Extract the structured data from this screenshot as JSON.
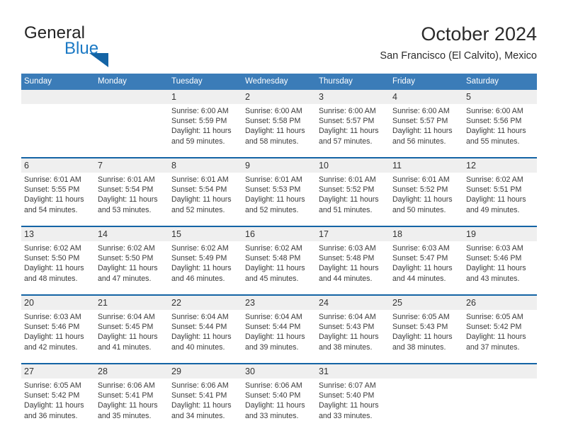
{
  "brand": {
    "name_part1": "General",
    "name_part2": "Blue",
    "triangle_color": "#1464a5",
    "blue_text_color": "#1b79c4"
  },
  "header": {
    "title": "October 2024",
    "subtitle": "San Francisco (El Calvito), Mexico",
    "accent_color": "#3b7cb8",
    "rule_color": "#1464a5",
    "daynum_band_color": "#efefef"
  },
  "weekday_headers": [
    "Sunday",
    "Monday",
    "Tuesday",
    "Wednesday",
    "Thursday",
    "Friday",
    "Saturday"
  ],
  "weeks": [
    {
      "days": [
        {
          "num": "",
          "sunrise": "",
          "sunset": "",
          "daylight_l1": "",
          "daylight_l2": "",
          "empty": true
        },
        {
          "num": "",
          "sunrise": "",
          "sunset": "",
          "daylight_l1": "",
          "daylight_l2": "",
          "empty": true
        },
        {
          "num": "1",
          "sunrise": "Sunrise: 6:00 AM",
          "sunset": "Sunset: 5:59 PM",
          "daylight_l1": "Daylight: 11 hours",
          "daylight_l2": "and 59 minutes.",
          "empty": false
        },
        {
          "num": "2",
          "sunrise": "Sunrise: 6:00 AM",
          "sunset": "Sunset: 5:58 PM",
          "daylight_l1": "Daylight: 11 hours",
          "daylight_l2": "and 58 minutes.",
          "empty": false
        },
        {
          "num": "3",
          "sunrise": "Sunrise: 6:00 AM",
          "sunset": "Sunset: 5:57 PM",
          "daylight_l1": "Daylight: 11 hours",
          "daylight_l2": "and 57 minutes.",
          "empty": false
        },
        {
          "num": "4",
          "sunrise": "Sunrise: 6:00 AM",
          "sunset": "Sunset: 5:57 PM",
          "daylight_l1": "Daylight: 11 hours",
          "daylight_l2": "and 56 minutes.",
          "empty": false
        },
        {
          "num": "5",
          "sunrise": "Sunrise: 6:00 AM",
          "sunset": "Sunset: 5:56 PM",
          "daylight_l1": "Daylight: 11 hours",
          "daylight_l2": "and 55 minutes.",
          "empty": false
        }
      ]
    },
    {
      "days": [
        {
          "num": "6",
          "sunrise": "Sunrise: 6:01 AM",
          "sunset": "Sunset: 5:55 PM",
          "daylight_l1": "Daylight: 11 hours",
          "daylight_l2": "and 54 minutes.",
          "empty": false
        },
        {
          "num": "7",
          "sunrise": "Sunrise: 6:01 AM",
          "sunset": "Sunset: 5:54 PM",
          "daylight_l1": "Daylight: 11 hours",
          "daylight_l2": "and 53 minutes.",
          "empty": false
        },
        {
          "num": "8",
          "sunrise": "Sunrise: 6:01 AM",
          "sunset": "Sunset: 5:54 PM",
          "daylight_l1": "Daylight: 11 hours",
          "daylight_l2": "and 52 minutes.",
          "empty": false
        },
        {
          "num": "9",
          "sunrise": "Sunrise: 6:01 AM",
          "sunset": "Sunset: 5:53 PM",
          "daylight_l1": "Daylight: 11 hours",
          "daylight_l2": "and 52 minutes.",
          "empty": false
        },
        {
          "num": "10",
          "sunrise": "Sunrise: 6:01 AM",
          "sunset": "Sunset: 5:52 PM",
          "daylight_l1": "Daylight: 11 hours",
          "daylight_l2": "and 51 minutes.",
          "empty": false
        },
        {
          "num": "11",
          "sunrise": "Sunrise: 6:01 AM",
          "sunset": "Sunset: 5:52 PM",
          "daylight_l1": "Daylight: 11 hours",
          "daylight_l2": "and 50 minutes.",
          "empty": false
        },
        {
          "num": "12",
          "sunrise": "Sunrise: 6:02 AM",
          "sunset": "Sunset: 5:51 PM",
          "daylight_l1": "Daylight: 11 hours",
          "daylight_l2": "and 49 minutes.",
          "empty": false
        }
      ]
    },
    {
      "days": [
        {
          "num": "13",
          "sunrise": "Sunrise: 6:02 AM",
          "sunset": "Sunset: 5:50 PM",
          "daylight_l1": "Daylight: 11 hours",
          "daylight_l2": "and 48 minutes.",
          "empty": false
        },
        {
          "num": "14",
          "sunrise": "Sunrise: 6:02 AM",
          "sunset": "Sunset: 5:50 PM",
          "daylight_l1": "Daylight: 11 hours",
          "daylight_l2": "and 47 minutes.",
          "empty": false
        },
        {
          "num": "15",
          "sunrise": "Sunrise: 6:02 AM",
          "sunset": "Sunset: 5:49 PM",
          "daylight_l1": "Daylight: 11 hours",
          "daylight_l2": "and 46 minutes.",
          "empty": false
        },
        {
          "num": "16",
          "sunrise": "Sunrise: 6:02 AM",
          "sunset": "Sunset: 5:48 PM",
          "daylight_l1": "Daylight: 11 hours",
          "daylight_l2": "and 45 minutes.",
          "empty": false
        },
        {
          "num": "17",
          "sunrise": "Sunrise: 6:03 AM",
          "sunset": "Sunset: 5:48 PM",
          "daylight_l1": "Daylight: 11 hours",
          "daylight_l2": "and 44 minutes.",
          "empty": false
        },
        {
          "num": "18",
          "sunrise": "Sunrise: 6:03 AM",
          "sunset": "Sunset: 5:47 PM",
          "daylight_l1": "Daylight: 11 hours",
          "daylight_l2": "and 44 minutes.",
          "empty": false
        },
        {
          "num": "19",
          "sunrise": "Sunrise: 6:03 AM",
          "sunset": "Sunset: 5:46 PM",
          "daylight_l1": "Daylight: 11 hours",
          "daylight_l2": "and 43 minutes.",
          "empty": false
        }
      ]
    },
    {
      "days": [
        {
          "num": "20",
          "sunrise": "Sunrise: 6:03 AM",
          "sunset": "Sunset: 5:46 PM",
          "daylight_l1": "Daylight: 11 hours",
          "daylight_l2": "and 42 minutes.",
          "empty": false
        },
        {
          "num": "21",
          "sunrise": "Sunrise: 6:04 AM",
          "sunset": "Sunset: 5:45 PM",
          "daylight_l1": "Daylight: 11 hours",
          "daylight_l2": "and 41 minutes.",
          "empty": false
        },
        {
          "num": "22",
          "sunrise": "Sunrise: 6:04 AM",
          "sunset": "Sunset: 5:44 PM",
          "daylight_l1": "Daylight: 11 hours",
          "daylight_l2": "and 40 minutes.",
          "empty": false
        },
        {
          "num": "23",
          "sunrise": "Sunrise: 6:04 AM",
          "sunset": "Sunset: 5:44 PM",
          "daylight_l1": "Daylight: 11 hours",
          "daylight_l2": "and 39 minutes.",
          "empty": false
        },
        {
          "num": "24",
          "sunrise": "Sunrise: 6:04 AM",
          "sunset": "Sunset: 5:43 PM",
          "daylight_l1": "Daylight: 11 hours",
          "daylight_l2": "and 38 minutes.",
          "empty": false
        },
        {
          "num": "25",
          "sunrise": "Sunrise: 6:05 AM",
          "sunset": "Sunset: 5:43 PM",
          "daylight_l1": "Daylight: 11 hours",
          "daylight_l2": "and 38 minutes.",
          "empty": false
        },
        {
          "num": "26",
          "sunrise": "Sunrise: 6:05 AM",
          "sunset": "Sunset: 5:42 PM",
          "daylight_l1": "Daylight: 11 hours",
          "daylight_l2": "and 37 minutes.",
          "empty": false
        }
      ]
    },
    {
      "days": [
        {
          "num": "27",
          "sunrise": "Sunrise: 6:05 AM",
          "sunset": "Sunset: 5:42 PM",
          "daylight_l1": "Daylight: 11 hours",
          "daylight_l2": "and 36 minutes.",
          "empty": false
        },
        {
          "num": "28",
          "sunrise": "Sunrise: 6:06 AM",
          "sunset": "Sunset: 5:41 PM",
          "daylight_l1": "Daylight: 11 hours",
          "daylight_l2": "and 35 minutes.",
          "empty": false
        },
        {
          "num": "29",
          "sunrise": "Sunrise: 6:06 AM",
          "sunset": "Sunset: 5:41 PM",
          "daylight_l1": "Daylight: 11 hours",
          "daylight_l2": "and 34 minutes.",
          "empty": false
        },
        {
          "num": "30",
          "sunrise": "Sunrise: 6:06 AM",
          "sunset": "Sunset: 5:40 PM",
          "daylight_l1": "Daylight: 11 hours",
          "daylight_l2": "and 33 minutes.",
          "empty": false
        },
        {
          "num": "31",
          "sunrise": "Sunrise: 6:07 AM",
          "sunset": "Sunset: 5:40 PM",
          "daylight_l1": "Daylight: 11 hours",
          "daylight_l2": "and 33 minutes.",
          "empty": false
        },
        {
          "num": "",
          "sunrise": "",
          "sunset": "",
          "daylight_l1": "",
          "daylight_l2": "",
          "empty": true
        },
        {
          "num": "",
          "sunrise": "",
          "sunset": "",
          "daylight_l1": "",
          "daylight_l2": "",
          "empty": true
        }
      ]
    }
  ]
}
